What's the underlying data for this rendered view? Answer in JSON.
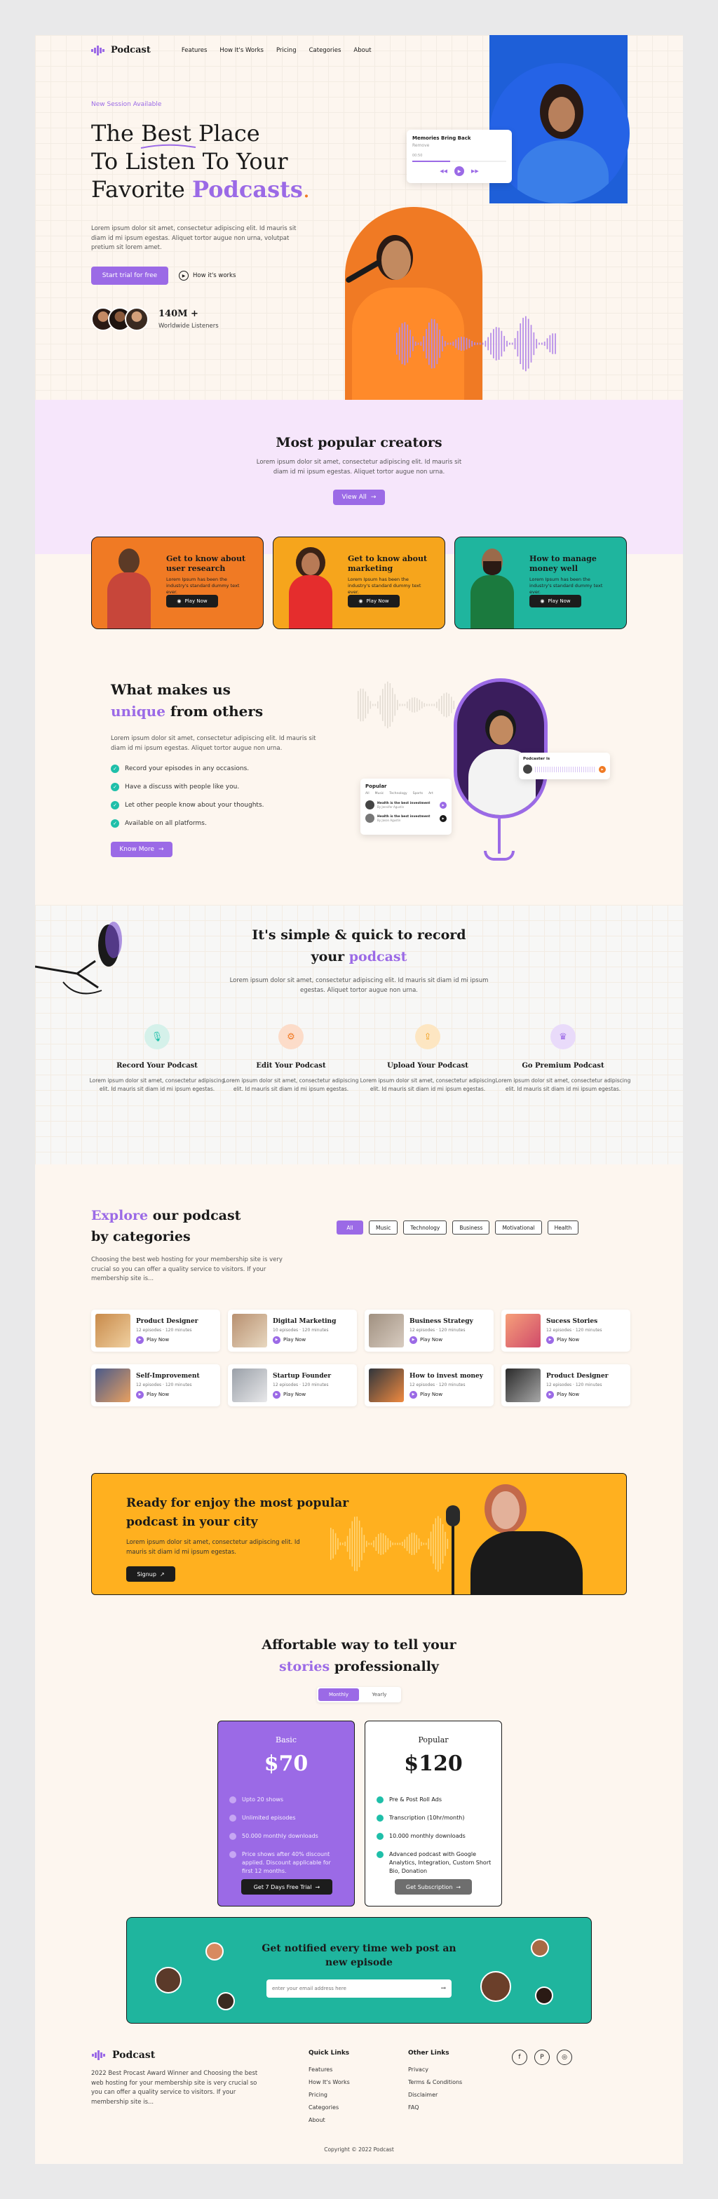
{
  "brand": {
    "name": "Podcast",
    "accent": "#9b6ae6",
    "orange": "#f07a24",
    "teal": "#1fbfa9",
    "yellow": "#ffb01f"
  },
  "nav": {
    "items": [
      "Features",
      "How It's Works",
      "Pricing",
      "Categories",
      "About"
    ]
  },
  "hero": {
    "eyebrow": "New Session Available",
    "line1a": "The ",
    "line1b": "Best",
    "line1c": " Place",
    "line2": "To Listen To Your",
    "line3a": "Favorite ",
    "line3b": "Podcasts",
    "desc": "Lorem ipsum dolor sit amet, consectetur adipiscing elit. Id mauris sit diam id mi ipsum egestas. Aliquet tortor augue non urna, volutpat pretium sit lorem amet.",
    "cta": "Start trial for free",
    "how": "How it's works",
    "stat": "140M +",
    "stat_label": "Worldwide Listeners",
    "player": {
      "title": "Memories Bring Back",
      "artist": "Remove",
      "time": "00:50"
    }
  },
  "creators": {
    "title": "Most popular creators",
    "desc": "Lorem ipsum dolor sit amet, consectetur adipiscing elit. Id mauris sit diam id mi ipsum egestas. Aliquet tortor augue non urna.",
    "view_all": "View All",
    "cards": [
      {
        "title": "Get to know about user research",
        "desc": "Lorem Ipsum has been the industry's standard dummy text ever.",
        "play": "Play Now"
      },
      {
        "title": "Get to know about marketing",
        "desc": "Lorem Ipsum has been the industry's standard dummy text ever.",
        "play": "Play Now"
      },
      {
        "title": "How to manage money well",
        "desc": "Lorem Ipsum has been the industry's standard dummy text ever.",
        "play": "Play Now"
      }
    ]
  },
  "unique": {
    "title1": "What makes us",
    "title2a": "unique",
    "title2b": " from others",
    "desc": "Lorem ipsum dolor sit amet, consectetur adipiscing elit. Id mauris sit diam id mi ipsum egestas. Aliquet tortor augue non urna.",
    "features": [
      "Record your episodes in any occasions.",
      "Have a discuss with people like you.",
      "Let other people know about your thoughts.",
      "Available on all platforms."
    ],
    "cta": "Know More",
    "popular": {
      "title": "Popular",
      "tabs": [
        "All",
        "Music",
        "Technology",
        "Sports",
        "Art"
      ],
      "items": [
        {
          "t": "Health is the best investment",
          "s": "By Jennifer Agustin"
        },
        {
          "t": "Health is the best investment",
          "s": "By Jason Agustin"
        }
      ]
    },
    "podcaster": "Podcaster is"
  },
  "record": {
    "title1": "It's simple & quick to record",
    "title2a": "your ",
    "title2b": "podcast",
    "desc": "Lorem ipsum dolor sit amet, consectetur adipiscing elit. Id mauris sit diam id mi ipsum egestas. Aliquet tortor augue non urna.",
    "steps": [
      {
        "title": "Record Your Podcast",
        "desc": "Lorem ipsum dolor sit amet, consectetur adipiscing elit. Id mauris sit diam id mi ipsum egestas."
      },
      {
        "title": "Edit Your Podcast",
        "desc": "Lorem ipsum dolor sit amet, consectetur adipiscing elit. Id mauris sit diam id mi ipsum egestas."
      },
      {
        "title": "Upload Your Podcast",
        "desc": "Lorem ipsum dolor sit amet, consectetur adipiscing elit. Id mauris sit diam id mi ipsum egestas."
      },
      {
        "title": "Go Premium Podcast",
        "desc": "Lorem ipsum dolor sit amet, consectetur adipiscing elit. Id mauris sit diam id mi ipsum egestas."
      }
    ]
  },
  "explore": {
    "title1a": "Explore",
    "title1b": " our podcast",
    "title2": "by categories",
    "desc": "Choosing the best web hosting for your membership site is very crucial so you can offer a quality service to visitors. If your membership site is...",
    "filters": [
      "All",
      "Music",
      "Technology",
      "Business",
      "Motivational",
      "Health"
    ],
    "cards": [
      {
        "title": "Product Designer",
        "meta": "12 episodes  ·  120 minutes",
        "play": "Play Now"
      },
      {
        "title": "Digital Marketing",
        "meta": "10 episodes  ·  120 minutes",
        "play": "Play Now"
      },
      {
        "title": "Business Strategy",
        "meta": "12 episodes  ·  120 minutes",
        "play": "Play Now"
      },
      {
        "title": "Sucess Stories",
        "meta": "12 episodes  ·  120 minutes",
        "play": "Play Now"
      },
      {
        "title": "Self-Improvement",
        "meta": "12 episodes  ·  120 minutes",
        "play": "Play Now"
      },
      {
        "title": "Startup Founder",
        "meta": "12 episodes  ·  120 minutes",
        "play": "Play Now"
      },
      {
        "title": "How to invest money",
        "meta": "12 episodes  ·  120 minutes",
        "play": "Play Now"
      },
      {
        "title": "Product Designer",
        "meta": "12 episodes  ·  120 minutes",
        "play": "Play Now"
      }
    ]
  },
  "banner": {
    "title": "Ready for enjoy the most popular podcast in your city",
    "desc": "Lorem ipsum dolor sit amet, consectetur adipiscing elit. Id mauris sit diam id mi ipsum egestas.",
    "cta": "Signup"
  },
  "pricing": {
    "title1": "Affortable way to tell your",
    "title2a": "stories",
    "title2b": " professionally",
    "toggle": [
      "Monthly",
      "Yearly"
    ],
    "plans": [
      {
        "name": "Basic",
        "price": "$70",
        "features": [
          "Upto 20 shows",
          "Unlimited episodes",
          "50.000 monthly downloads",
          "Price shows after 40% discount applied. Discount applicable for first 12 months."
        ],
        "cta": "Get 7 Days Free Trial"
      },
      {
        "name": "Popular",
        "price": "$120",
        "features": [
          "Pre & Post Roll Ads",
          "Transcription (10hr/month)",
          "10.000 monthly downloads",
          "Advanced podcast with Google Analytics, Integration, Custom Short Bio, Donation"
        ],
        "cta": "Get Subscription"
      }
    ]
  },
  "newsletter": {
    "title": "Get notified every time web post an new episode",
    "placeholder": "enter your email address here"
  },
  "footer": {
    "desc": "2022 Best Procast Award Winner and Choosing the best web hosting for your membership site is very crucial so you can offer a quality service to visitors. If your membership site is...",
    "quick_title": "Quick Links",
    "quick": [
      "Features",
      "How It's Works",
      "Pricing",
      "Categories",
      "About"
    ],
    "other_title": "Other Links",
    "other": [
      "Privacy",
      "Terms & Conditions",
      "Disclaimer",
      "FAQ"
    ],
    "social": [
      "f",
      "P",
      "◎"
    ],
    "copyright": "Copyright © 2022 Podcast"
  }
}
